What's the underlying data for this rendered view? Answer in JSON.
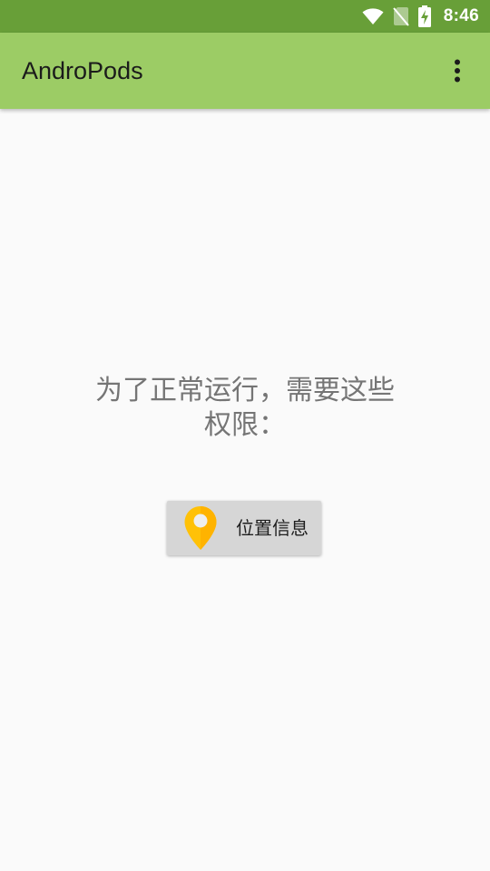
{
  "status_bar": {
    "time": "8:46",
    "icons": [
      "wifi-icon",
      "no-sim-icon",
      "battery-charging-icon"
    ]
  },
  "app_bar": {
    "title": "AndroPods",
    "menu_icon": "more-vert-icon"
  },
  "permission_message": {
    "line1": "为了正常运行，需要这些",
    "line2": "权限："
  },
  "location_button": {
    "label": "位置信息",
    "icon": "location-pin-icon"
  },
  "colors": {
    "status_bar": "#689f38",
    "app_bar": "#9ccc65",
    "background": "#fafafa",
    "button": "#d6d6d6",
    "pin_primary": "#ffc107",
    "pin_shade": "#ffb300"
  }
}
